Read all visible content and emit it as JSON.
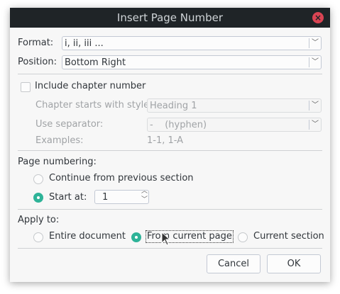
{
  "title": "Insert Page Number",
  "format": {
    "label": "Format:",
    "value": "i, ii, iii ..."
  },
  "position": {
    "label": "Position:",
    "value": "Bottom Right"
  },
  "include_chapter": {
    "label": "Include chapter number",
    "checked": false
  },
  "chapter_style": {
    "label": "Chapter starts with style:",
    "value": "Heading 1"
  },
  "separator": {
    "label": "Use separator:",
    "value": "-    (hyphen)"
  },
  "examples": {
    "label": "Examples:",
    "value": "1-1, 1-A"
  },
  "page_numbering": {
    "label": "Page numbering:",
    "continue": "Continue from previous section",
    "start_at": "Start at:",
    "start_value": "1",
    "selected": "start_at"
  },
  "apply_to": {
    "label": "Apply to:",
    "options": [
      "Entire document",
      "From current page",
      "Current section"
    ],
    "selected": "From current page"
  },
  "buttons": {
    "cancel": "Cancel",
    "ok": "OK"
  },
  "colors": {
    "accent": "#2eb398",
    "titlebar": "#1f2427",
    "close": "#da4453"
  }
}
